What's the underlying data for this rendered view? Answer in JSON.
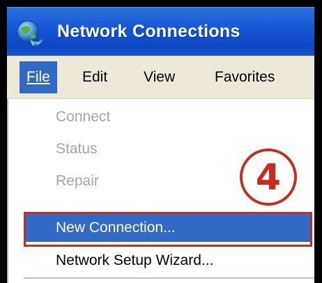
{
  "window": {
    "title": "Network Connections",
    "icon": "network-globe-icon"
  },
  "menubar": {
    "items": [
      {
        "label": "File",
        "underline": "F",
        "active": true
      },
      {
        "label": "Edit",
        "underline": "E",
        "active": false
      },
      {
        "label": "View",
        "underline": "V",
        "active": false
      },
      {
        "label": "Favorites",
        "underline": "a",
        "active": false
      }
    ]
  },
  "file_menu": {
    "items": [
      {
        "label": "Connect",
        "enabled": false
      },
      {
        "label": "Status",
        "enabled": false
      },
      {
        "label": "Repair",
        "enabled": false
      },
      {
        "label": "New Connection...",
        "enabled": true,
        "highlighted": true
      },
      {
        "label": "Network Setup Wizard...",
        "enabled": true
      }
    ]
  },
  "annotation": {
    "step_number": "4",
    "color": "#c72d1e"
  },
  "colors": {
    "titlebar": "#1556d3",
    "menu_highlight": "#316ac5",
    "menubar_bg": "#ece9d8",
    "disabled_text": "#a7a59a"
  }
}
